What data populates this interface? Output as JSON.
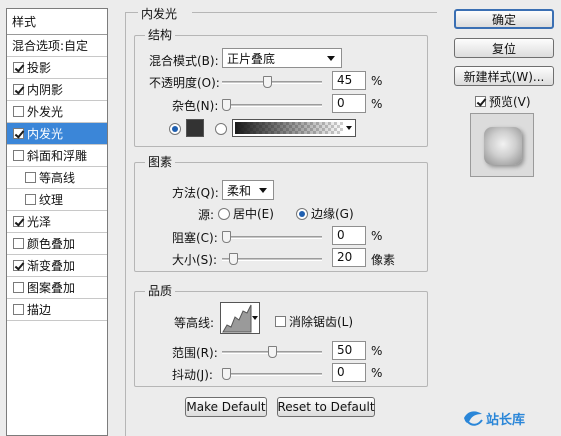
{
  "left_panel": {
    "header": "样式",
    "items": [
      {
        "label": "混合选项:自定",
        "checkbox": false,
        "checked": false
      },
      {
        "label": "投影",
        "checkbox": true,
        "checked": true
      },
      {
        "label": "内阴影",
        "checkbox": true,
        "checked": true
      },
      {
        "label": "外发光",
        "checkbox": true,
        "checked": false
      },
      {
        "label": "内发光",
        "checkbox": true,
        "checked": true,
        "selected": true
      },
      {
        "label": "斜面和浮雕",
        "checkbox": true,
        "checked": false
      },
      {
        "label": "等高线",
        "checkbox": true,
        "checked": false,
        "indent": true
      },
      {
        "label": "纹理",
        "checkbox": true,
        "checked": false,
        "indent": true
      },
      {
        "label": "光泽",
        "checkbox": true,
        "checked": true
      },
      {
        "label": "颜色叠加",
        "checkbox": true,
        "checked": false
      },
      {
        "label": "渐变叠加",
        "checkbox": true,
        "checked": true
      },
      {
        "label": "图案叠加",
        "checkbox": true,
        "checked": false
      },
      {
        "label": "描边",
        "checkbox": true,
        "checked": false
      }
    ]
  },
  "panel_title": "内发光",
  "structure": {
    "title": "结构",
    "blend_mode_label": "混合模式(B):",
    "blend_mode_value": "正片叠底",
    "opacity_label": "不透明度(O):",
    "opacity_value": "45",
    "opacity_unit": "%",
    "noise_label": "杂色(N):",
    "noise_value": "0",
    "noise_unit": "%",
    "glow_color": "#333333"
  },
  "elements": {
    "title": "图素",
    "method_label": "方法(Q):",
    "method_value": "柔和",
    "source_label": "源:",
    "center_label": "居中(E)",
    "edge_label": "边缘(G)",
    "choke_label": "阻塞(C):",
    "choke_value": "0",
    "choke_unit": "%",
    "size_label": "大小(S):",
    "size_value": "20",
    "size_unit": "像素"
  },
  "quality": {
    "title": "品质",
    "contour_label": "等高线:",
    "antialias_label": "消除锯齿(L)",
    "range_label": "范围(R):",
    "range_value": "50",
    "range_unit": "%",
    "jitter_label": "抖动(J):",
    "jitter_value": "0",
    "jitter_unit": "%"
  },
  "buttons": {
    "make_default": "Make Default",
    "reset_default": "Reset to Default",
    "ok": "确定",
    "reset": "复位",
    "new_style": "新建样式(W)...",
    "preview": "预览(V)"
  },
  "watermark": "站长库",
  "colors": {
    "accent": "#3b86d8",
    "selected_text": "#ffffff"
  },
  "slider_positions": {
    "opacity": 0.45,
    "noise": 0.0,
    "choke": 0.0,
    "size": 0.08,
    "range": 0.5,
    "jitter": 0.0
  }
}
